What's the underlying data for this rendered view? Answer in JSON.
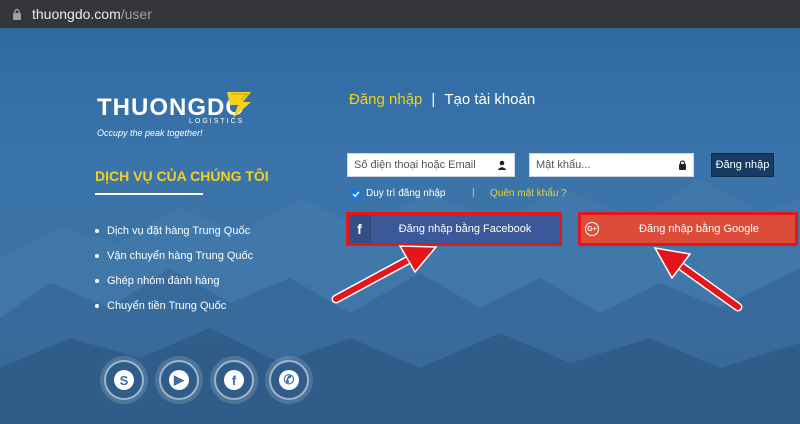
{
  "browser": {
    "url_host": "thuongdo.com",
    "url_path": "/user"
  },
  "brand": {
    "name": "THUONGDO",
    "sub": "LOGISTICS",
    "tagline": "Occupy the peak together!",
    "accent_color": "#f2d21d"
  },
  "services": {
    "title": "DỊCH VỤ CỦA CHÚNG TÔI",
    "items": [
      "Dịch vụ đặt hàng Trung Quốc",
      "Vận chuyển hàng Trung Quốc",
      "Ghép nhóm đánh hàng",
      "Chuyển tiền Trung Quốc"
    ]
  },
  "socials": [
    "skype-icon",
    "youtube-icon",
    "facebook-icon",
    "whatsapp-icon"
  ],
  "auth": {
    "tab_login": "Đăng nhập",
    "tab_separator": "|",
    "tab_register": "Tạo tài khoản",
    "phone_placeholder": "Số điện thoại hoặc Email",
    "password_placeholder": "Mật khẩu...",
    "login_button": "Đăng nhập",
    "remember_label": "Duy trì đăng nhập",
    "remember_checked": true,
    "divider": "|",
    "forgot_label": "Quên mật khẩu ?",
    "facebook_label": "Đăng nhập bằng Facebook",
    "google_label": "Đăng nhập bằng Google",
    "facebook_color": "#3b5998",
    "google_color": "#dd4b39",
    "highlight_color": "#e3171b"
  }
}
